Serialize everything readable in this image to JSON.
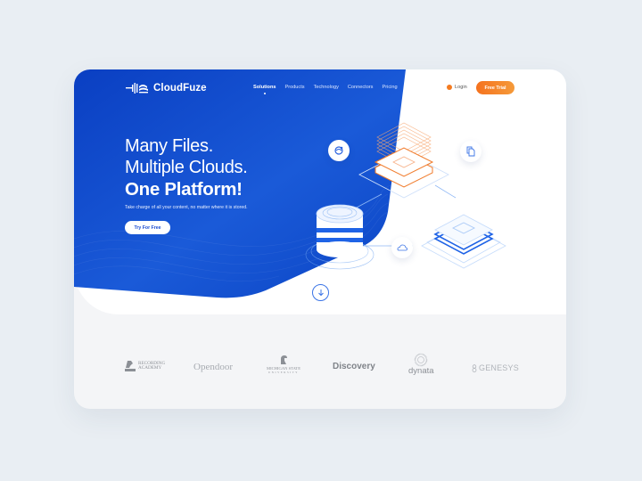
{
  "brand": {
    "name": "CloudFuze"
  },
  "nav": {
    "items": [
      {
        "label": "Solutions",
        "active": true
      },
      {
        "label": "Products",
        "active": false
      },
      {
        "label": "Technology",
        "active": false
      },
      {
        "label": "Connectors",
        "active": false
      },
      {
        "label": "Pricing",
        "active": false
      }
    ],
    "login_label": "Login",
    "free_trial_label": "Free Trial"
  },
  "hero": {
    "line1": "Many Files.",
    "line2": "Multiple Clouds.",
    "line3": "One Platform!",
    "subtitle": "Take charge of all your content, no matter where it is stored.",
    "cta_label": "Try For Free"
  },
  "illustration": {
    "icons": [
      "sync-globe-icon",
      "document-icon",
      "cloud-icon",
      "scroll-down-icon"
    ]
  },
  "clients": [
    {
      "name": "Recording Academy",
      "line1": "RECORDING",
      "line2": "ACADEMY"
    },
    {
      "name": "Opendoor"
    },
    {
      "name": "Michigan State University",
      "line1": "MICHIGAN STATE",
      "line2": "UNIVERSITY"
    },
    {
      "name": "Discovery"
    },
    {
      "name": "dynata"
    },
    {
      "name": "GENESYS"
    }
  ],
  "colors": {
    "primary_blue": "#1a4fd1",
    "accent_orange": "#f5731e",
    "background": "#e9eef3"
  }
}
